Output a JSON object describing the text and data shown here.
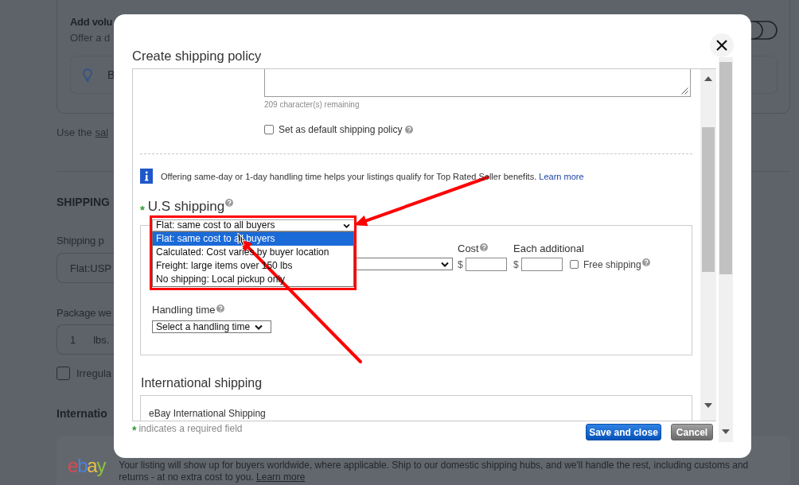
{
  "background": {
    "promo_card": {
      "title": "Add volu",
      "subtitle": "Offer a d",
      "toggle": {
        "on": false
      },
      "tip": "B"
    },
    "note": {
      "text": "Use the",
      "link": "sal"
    },
    "section_heading": "SHIPPING",
    "shipping_policy": {
      "label": "Shipping p",
      "value": "Flat:USP"
    },
    "package_weight": {
      "label": "Package we",
      "value": "1",
      "unit": "lbs."
    },
    "irregular_package": {
      "label": "Irregula",
      "checked": false
    },
    "international_heading": "Internatio",
    "program": {
      "logo": "ebay",
      "text": "Your listing will show up for buyers worldwide, where applicable. Ship to our domestic shipping hubs, and we'll handle the rest, including customs and returns - at no extra cost to you.",
      "link": "Learn more"
    }
  },
  "dialog": {
    "title": "Create shipping policy",
    "description_counter": "209 character(s) remaining",
    "default_policy": {
      "label": "Set as default shipping policy",
      "checked": false
    },
    "notice": {
      "text": "Offering same-day or 1-day handling time helps your listings qualify for Top Rated Seller benefits.",
      "link": "Learn more"
    },
    "us_shipping": {
      "required_mark": "*",
      "label": "U.S shipping",
      "type_select": {
        "value": "Flat: same cost to all buyers",
        "expanded": true,
        "options": [
          {
            "label": "Flat: same cost to all buyers",
            "selected": true
          },
          {
            "label": "Calculated: Cost varies by buyer location",
            "selected": false
          },
          {
            "label": "Freight: large items over 150 lbs",
            "selected": false
          },
          {
            "label": "No shipping: Local pickup only",
            "selected": false
          }
        ]
      },
      "cost_label": "Cost",
      "cost_currency": "$",
      "additional_label": "Each additional",
      "additional_currency": "$",
      "free_shipping": {
        "label": "Free shipping",
        "checked": false
      },
      "handling_time_label": "Handling time",
      "handling_time_select": {
        "value": "Select a handling time"
      }
    },
    "international_shipping": {
      "heading": "International shipping",
      "option": "eBay International Shipping"
    },
    "footer": {
      "required_mark": "*",
      "note": "indicates a required field"
    },
    "buttons": [
      {
        "label": "Save and close",
        "kind": "primary"
      },
      {
        "label": "Cancel",
        "kind": "secondary"
      }
    ]
  }
}
